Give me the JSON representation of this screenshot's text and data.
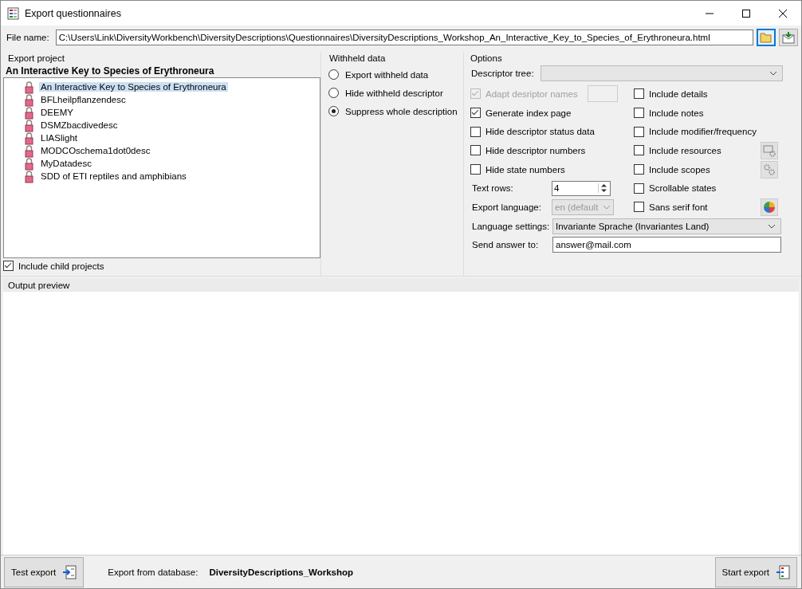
{
  "window": {
    "title": "Export questionnaires"
  },
  "file_name": {
    "label": "File name:",
    "value": "C:\\Users\\Link\\DiversityWorkbench\\DiversityDescriptions\\Questionnaires\\DiversityDescriptions_Workshop_An_Interactive_Key_to_Species_of_Erythroneura.html"
  },
  "export_project": {
    "title": "Export project",
    "current_project": "An Interactive Key to Species of Erythroneura",
    "projects": [
      {
        "label": "An Interactive Key to Species of Erythroneura",
        "selected": true
      },
      {
        "label": "BFLheilpflanzendesc",
        "selected": false
      },
      {
        "label": "DEEMY",
        "selected": false
      },
      {
        "label": "DSMZbacdivedesc",
        "selected": false
      },
      {
        "label": "LIASlight",
        "selected": false
      },
      {
        "label": "MODCOschema1dot0desc",
        "selected": false
      },
      {
        "label": "MyDatadesc",
        "selected": false
      },
      {
        "label": "SDD of ETI reptiles and amphibians",
        "selected": false
      }
    ],
    "include_child_projects": {
      "label": "Include child projects",
      "checked": true
    }
  },
  "withheld_data": {
    "title": "Withheld data",
    "options": [
      {
        "label": "Export withheld data",
        "selected": false
      },
      {
        "label": "Hide withheld descriptor",
        "selected": false
      },
      {
        "label": "Suppress whole description",
        "selected": true
      }
    ]
  },
  "options": {
    "title": "Options",
    "descriptor_tree": {
      "label": "Descriptor tree:"
    },
    "left_items": [
      {
        "kind": "check-field",
        "label": "Adapt desriptor names",
        "checked": true,
        "disabled": true
      },
      {
        "kind": "check",
        "label": "Generate index page",
        "checked": true,
        "disabled": false
      },
      {
        "kind": "check",
        "label": "Hide descriptor status data",
        "checked": false,
        "disabled": false
      },
      {
        "kind": "check",
        "label": "Hide descriptor numbers",
        "checked": false,
        "disabled": false
      },
      {
        "kind": "check",
        "label": "Hide state numbers",
        "checked": false,
        "disabled": false
      },
      {
        "kind": "spin",
        "label": "Text rows:",
        "value": "4"
      },
      {
        "kind": "combo",
        "label": "Export language:",
        "value": "en (default",
        "disabled": true
      }
    ],
    "right_items": [
      {
        "kind": "check",
        "label": "Include details",
        "checked": false
      },
      {
        "kind": "check",
        "label": "Include notes",
        "checked": false
      },
      {
        "kind": "check",
        "label": "Include modifier/frequency",
        "checked": false
      },
      {
        "kind": "resources",
        "label": "Include resources",
        "checked": false
      },
      {
        "kind": "scopes",
        "label": "Include scopes",
        "checked": false
      },
      {
        "kind": "check",
        "label": "Scrollable states",
        "checked": false
      },
      {
        "kind": "font",
        "label": "Sans serif font",
        "checked": false
      }
    ],
    "language_settings": {
      "label": "Language settings:",
      "value": "Invariante Sprache (Invariantes Land)"
    },
    "send_answer_to": {
      "label": "Send answer to:",
      "value": "answer@mail.com"
    }
  },
  "output_preview": {
    "title": "Output preview"
  },
  "footer": {
    "test_export": "Test export",
    "database_label": "Export from database:",
    "database": "DiversityDescriptions_Workshop",
    "start_export": "Start export"
  }
}
